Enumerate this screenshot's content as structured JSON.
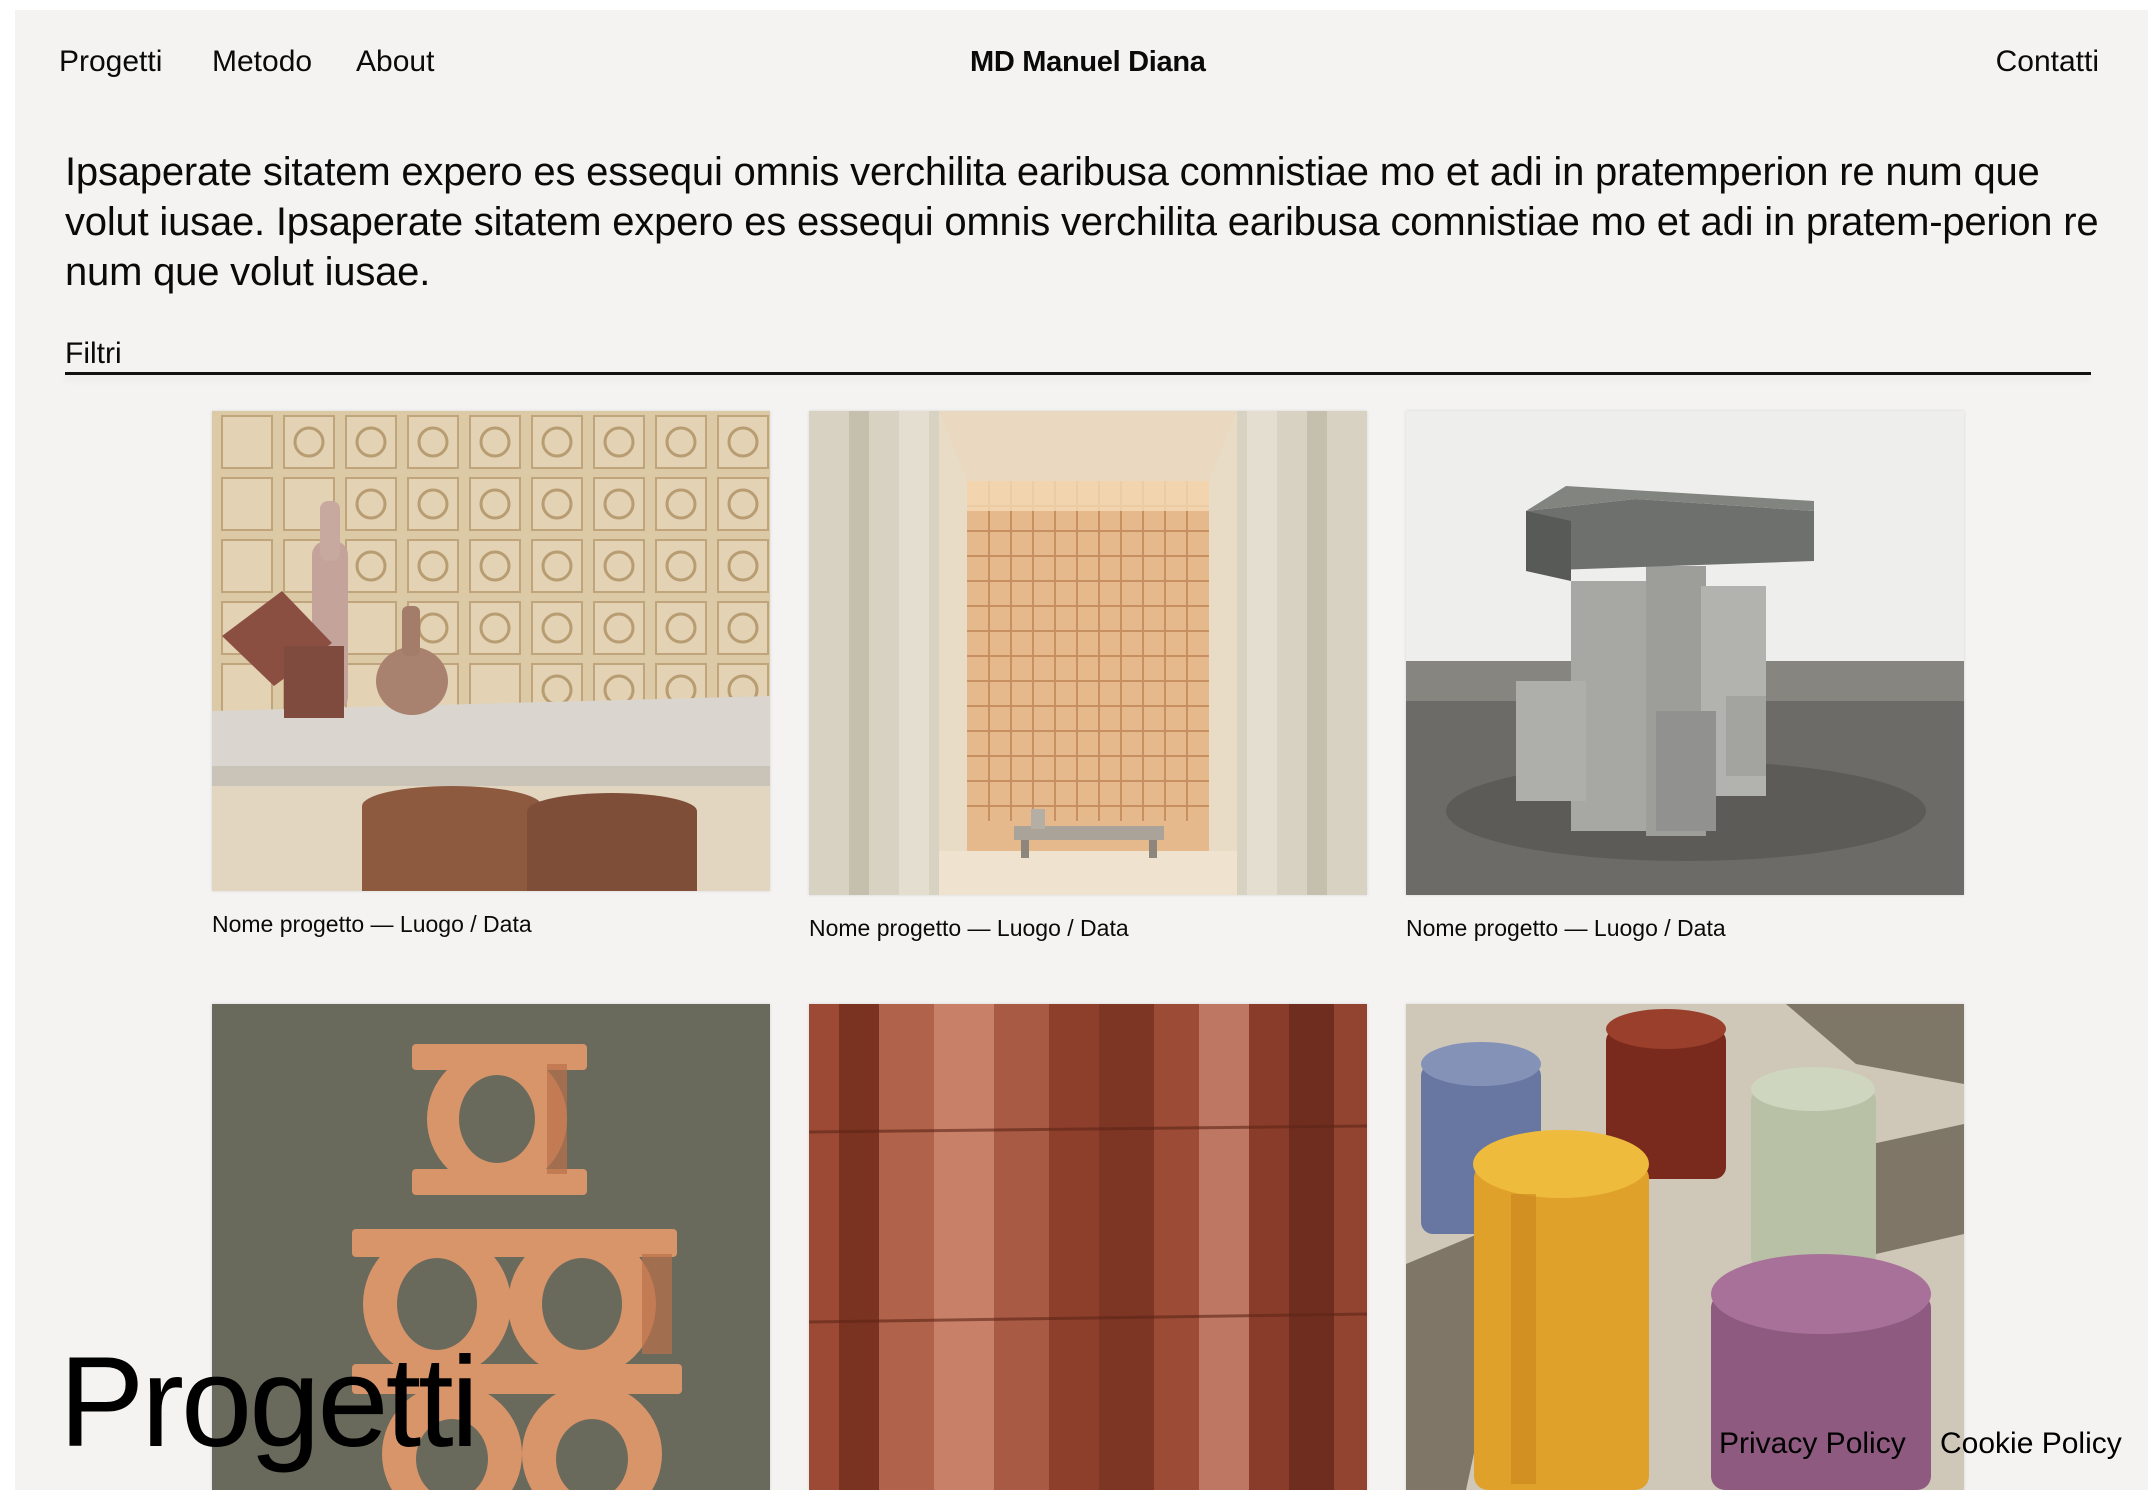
{
  "header": {
    "nav": [
      "Progetti",
      "Metodo",
      "About"
    ],
    "brand": "MD Manuel Diana",
    "contact": "Contatti"
  },
  "intro": {
    "text": "Ipsaperate sitatem expero es essequi omnis verchilita earibusa comnistiae mo et adi in pratemperion re num que volut iusae. Ipsaperate sitatem expero es essequi omnis verchilita earibusa comnistiae mo et adi in pratem-perion re num que volut iusae."
  },
  "filters": {
    "label": "Filtri"
  },
  "projects": [
    {
      "caption": "Nome progetto — Luogo / Data",
      "image": "ceramic-tile-wall-with-vases"
    },
    {
      "caption": "Nome progetto — Luogo / Data",
      "image": "terracotta-alcove-with-bench"
    },
    {
      "caption": "Nome progetto — Luogo / Data",
      "image": "stone-stool"
    },
    {
      "caption": "",
      "image": "stacked-ring-bricks"
    },
    {
      "caption": "",
      "image": "brick-pillar-close-up"
    },
    {
      "caption": "",
      "image": "marble-stools"
    }
  ],
  "page": {
    "heading": "Progetti"
  },
  "footer": {
    "privacy": "Privacy Policy",
    "cookie": "Cookie Policy"
  },
  "colors": {
    "background": "#f4f3f1",
    "text": "#0a0a0a"
  }
}
